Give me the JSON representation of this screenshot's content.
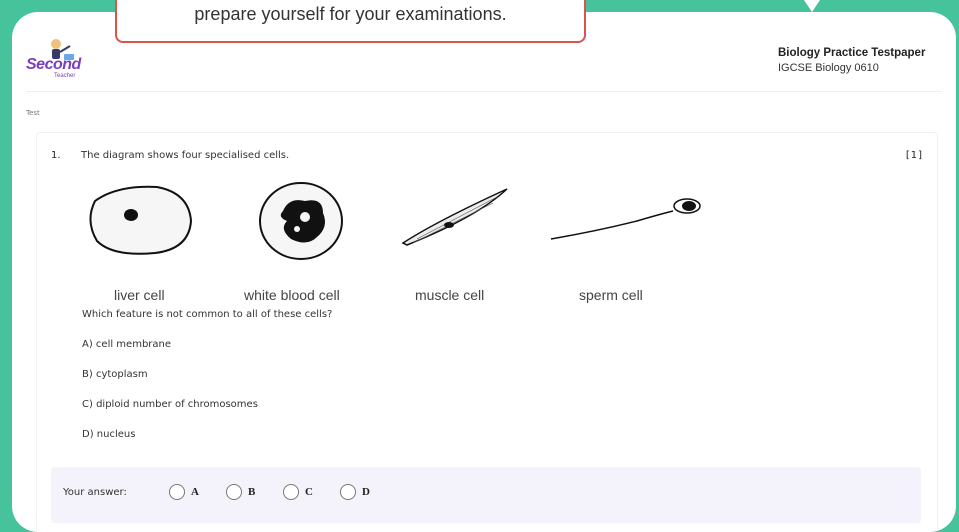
{
  "banner": {
    "text": "prepare yourself for your examinations."
  },
  "logo": {
    "brand": "Second",
    "sub": "Teacher"
  },
  "header": {
    "title": "Biology Practice Testpaper",
    "subtitle": "IGCSE Biology 0610"
  },
  "section_label": "Test",
  "question": {
    "number": "1.",
    "text": "The diagram shows four specialised cells.",
    "marks": "[1]",
    "cells": [
      "liver cell",
      "white blood cell",
      "muscle cell",
      "sperm cell"
    ],
    "prompt": "Which feature is not common to all of these cells?",
    "options": [
      {
        "key": "A",
        "text": "A) cell membrane"
      },
      {
        "key": "B",
        "text": "B) cytoplasm"
      },
      {
        "key": "C",
        "text": "C) diploid number of chromosomes"
      },
      {
        "key": "D",
        "text": "D) nucleus"
      }
    ]
  },
  "answer": {
    "label": "Your answer:",
    "choices": [
      "A",
      "B",
      "C",
      "D"
    ]
  },
  "colors": {
    "background": "#47c39c",
    "banner_border": "#d9534f",
    "logo": "#7a3fbf",
    "answer_bg": "#f4f2fb"
  }
}
